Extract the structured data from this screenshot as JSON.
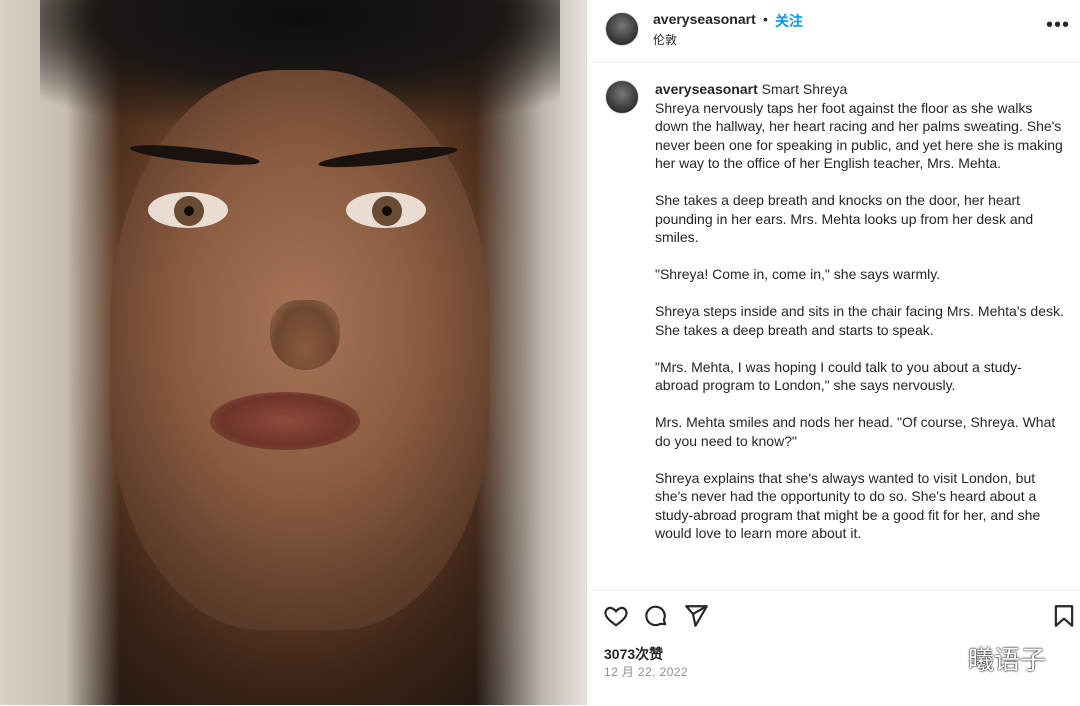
{
  "post": {
    "username": "averyseasonart",
    "separator": "•",
    "follow_label": "关注",
    "location": "伦敦",
    "more_label": "•••"
  },
  "caption": {
    "username": "averyseasonart",
    "title": "Smart Shreya",
    "paragraphs": [
      "Shreya nervously taps her foot against the floor as she walks down the hallway, her heart racing and her palms sweating. She's never been one for speaking in public, and yet here she is making her way to the office of her English teacher, Mrs. Mehta.",
      "She takes a deep breath and knocks on the door, her heart pounding in her ears. Mrs. Mehta looks up from her desk and smiles.",
      "\"Shreya! Come in, come in,\" she says warmly.",
      "Shreya steps inside and sits in the chair facing Mrs. Mehta's desk. She takes a deep breath and starts to speak.",
      "\"Mrs. Mehta, I was hoping I could talk to you about a study-abroad program to London,\" she says nervously.",
      "Mrs. Mehta smiles and nods her head. \"Of course, Shreya. What do you need to know?\"",
      "Shreya explains that she's always wanted to visit London, but she's never had the opportunity to do so. She's heard about a study-abroad program that might be a good fit for her, and she would love to learn more about it."
    ]
  },
  "stats": {
    "likes": "3073次赞",
    "date": "12 月 22, 2022"
  },
  "icons": {
    "like": "heart-icon",
    "comment": "comment-icon",
    "share": "send-icon",
    "save": "bookmark-icon"
  },
  "watermark": {
    "text": "曦语子"
  }
}
